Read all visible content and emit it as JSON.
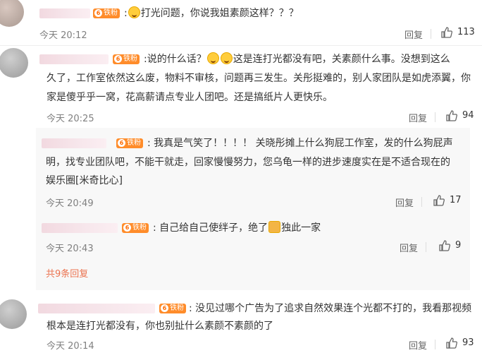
{
  "comments": [
    {
      "text": "打光问题，你说我姐素颜这样？？？",
      "badge": "铁粉",
      "time": "今天 20:12",
      "reply_label": "回复",
      "likes": "113"
    },
    {
      "text_a": "说的什么话？",
      "text_b": "这是连打光都没有吧，关素颜什么事。没想到这么",
      "text_2": "久了，工作室依然这么废，物料不审核，问题再三发生。关彤挺难的，别人家团队是如虎添翼，你",
      "text_3": "家是傻乎乎一窝，花高薪请点专业人团吧。还是搞纸片人更快乐。",
      "badge": "铁粉",
      "time": "今天 20:25",
      "reply_label": "回复",
      "likes": "94",
      "replies": [
        {
          "text_1": "我真是气笑了！！！！ 关晓彤摊上什么狗屁工作室，发的什么狗屁声",
          "text_2": "明，找专业团队吧，不能干就走，回家慢慢努力，您乌龟一样的进步速度实在是不适合现在的",
          "text_3": "娱乐圈[米奇比心]",
          "badge": "铁粉",
          "time": "今天 20:49",
          "reply_label": "回复",
          "likes": "17"
        },
        {
          "text_a": "自己给自己使绊子，绝了",
          "text_b": "独此一家",
          "badge": "铁粉",
          "time": "今天 20:43",
          "reply_label": "回复",
          "likes": "9"
        }
      ],
      "more_replies": "共9条回复"
    },
    {
      "text_1": "没见过哪个广告为了追求自然效果连个光都不打的，我看那视频",
      "text_2": "根本是连打光都没有，你也别扯什么素颜不素颜的了",
      "badge": "铁粉",
      "time": "今天 20:14",
      "reply_label": "回复",
      "likes": "93"
    }
  ]
}
